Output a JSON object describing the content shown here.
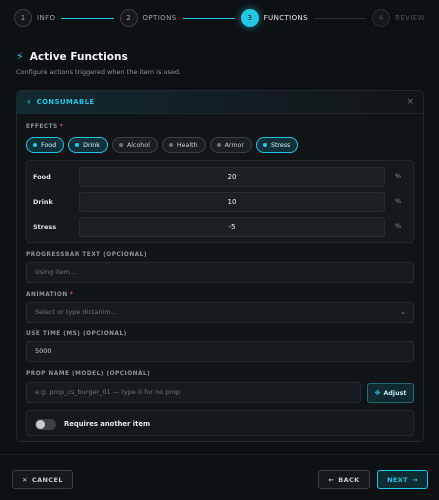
{
  "steps": [
    {
      "num": "1",
      "label": "INFO"
    },
    {
      "num": "2",
      "label": "OPTIONS"
    },
    {
      "num": "3",
      "label": "FUNCTIONS"
    },
    {
      "num": "4",
      "label": "REVIEW"
    }
  ],
  "section": {
    "title": "Active Functions",
    "subtitle": "Configure actions triggered when the item is used."
  },
  "card": {
    "title": "CONSUMABLE",
    "close": "×"
  },
  "effects": {
    "label": "EFFECTS",
    "required": "*",
    "chips": [
      {
        "label": "Food",
        "active": true
      },
      {
        "label": "Drink",
        "active": true
      },
      {
        "label": "Alcohol",
        "active": false
      },
      {
        "label": "Health",
        "active": false
      },
      {
        "label": "Armor",
        "active": false
      },
      {
        "label": "Stress",
        "active": true
      }
    ],
    "rows": [
      {
        "name": "Food",
        "value": "20",
        "unit": "%"
      },
      {
        "name": "Drink",
        "value": "10",
        "unit": "%"
      },
      {
        "name": "Stress",
        "value": "-5",
        "unit": "%"
      }
    ]
  },
  "progressbar": {
    "label": "PROGRESSBAR TEXT (OPCIONAL)",
    "placeholder": "Using item..."
  },
  "animation": {
    "label": "ANIMATION",
    "required": "*",
    "placeholder": "Select or type dictanim..."
  },
  "usetime": {
    "label": "USE TIME (MS) (OPCIONAL)",
    "value": "5000"
  },
  "prop": {
    "label": "PROP NAME (MODEL) (OPCIONAL)",
    "placeholder": "e.g. prop_cs_burger_01 — type 0 for no prop",
    "adjust_label": "Adjust"
  },
  "requires": {
    "label": "Requires another item"
  },
  "footer": {
    "cancel": "CANCEL",
    "back": "BACK",
    "next": "NEXT"
  },
  "colors": {
    "accent": "#22c7e6",
    "background": "#0e1114",
    "required": "#e25555"
  }
}
